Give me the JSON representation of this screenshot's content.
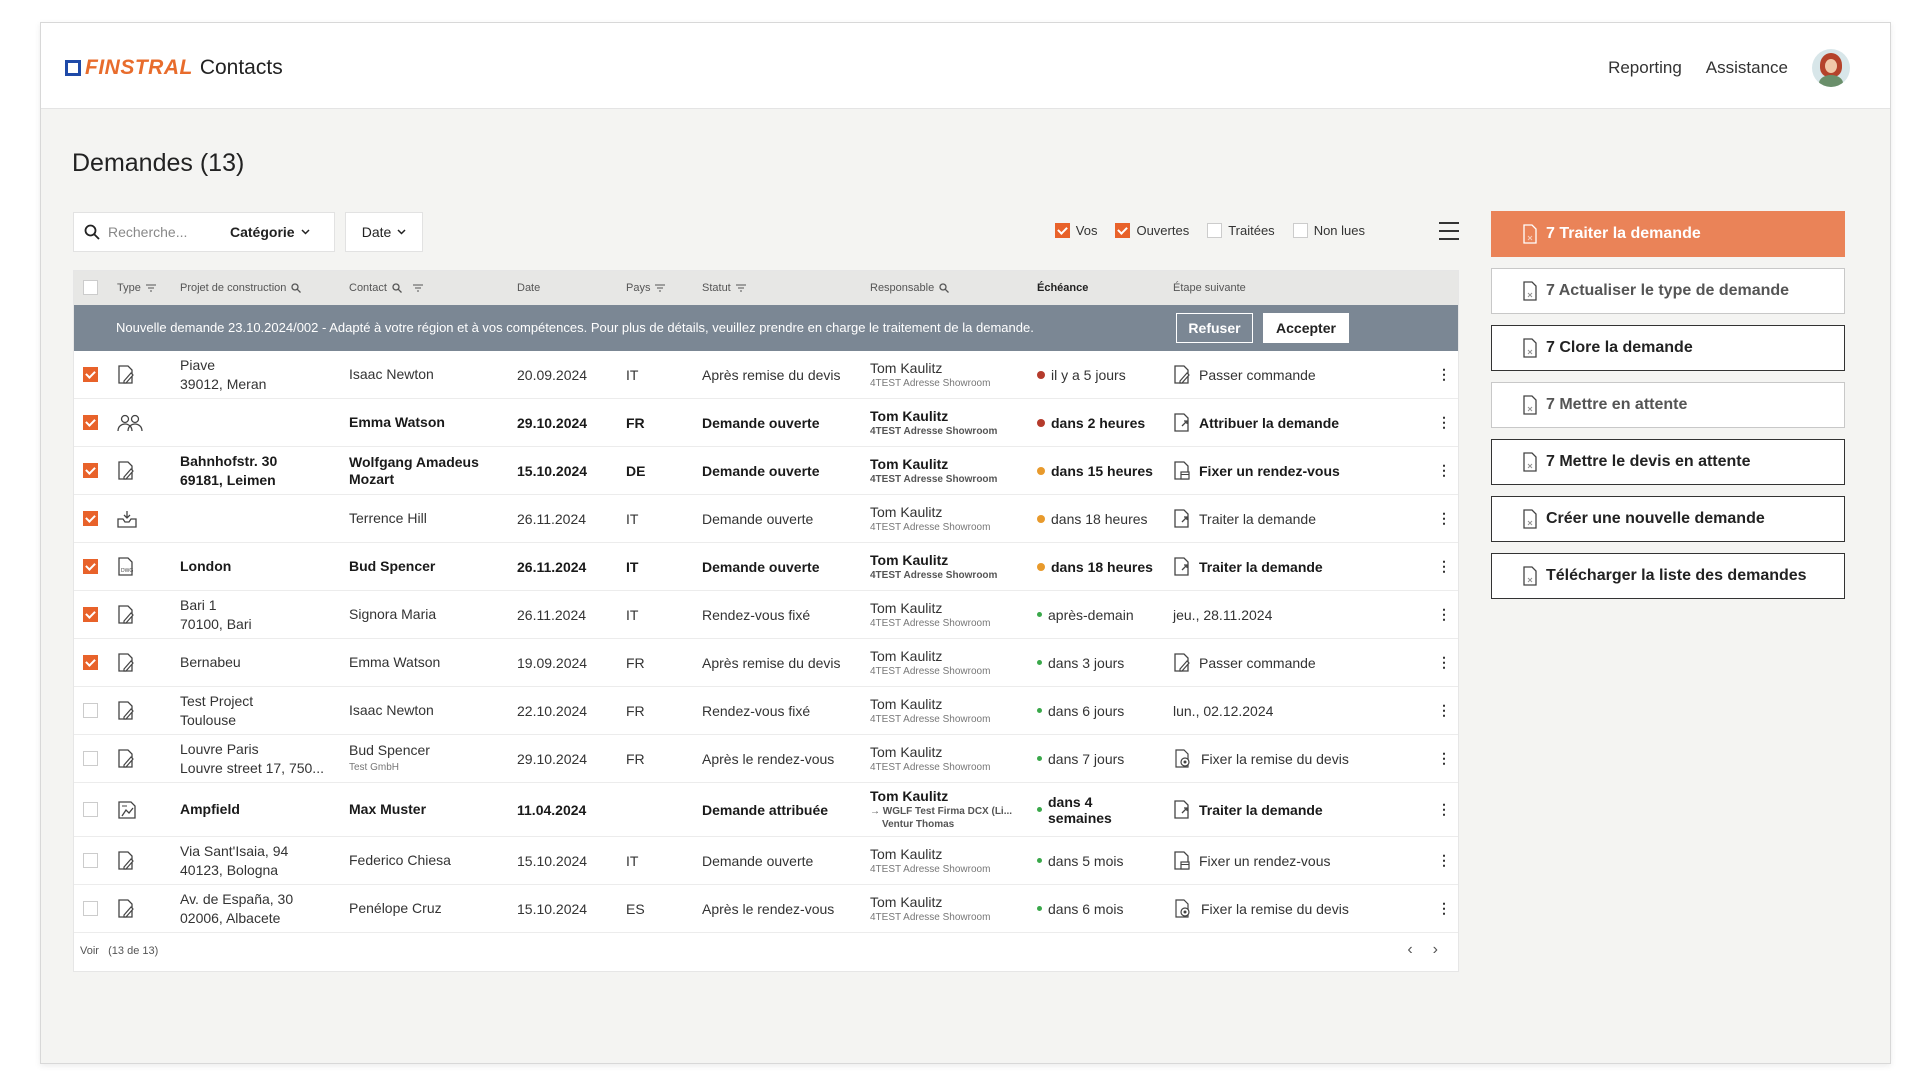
{
  "header": {
    "brand": "FINSTRAL",
    "app": "Contacts",
    "nav": [
      "Reporting",
      "Assistance"
    ]
  },
  "page": {
    "title": "Demandes (13)"
  },
  "toolbar": {
    "search_placeholder": "Recherche...",
    "category": "Catégorie",
    "date": "Date",
    "filters": [
      {
        "label": "Vos",
        "checked": true
      },
      {
        "label": "Ouvertes",
        "checked": true
      },
      {
        "label": "Traitées",
        "checked": false
      },
      {
        "label": "Non lues",
        "checked": false
      }
    ]
  },
  "table": {
    "columns": {
      "type": "Type",
      "project": "Projet de construction",
      "contact": "Contact",
      "date": "Date",
      "country": "Pays",
      "status": "Statut",
      "responsible": "Responsable",
      "due": "Échéance",
      "next_step": "Étape suivante"
    },
    "banner": {
      "text": "Nouvelle demande 23.10.2024/002 - Adapté à votre région et à vos compétences. Pour plus de détails, veuillez prendre en charge le traitement de la demande.",
      "refuse": "Refuser",
      "accept": "Accepter"
    },
    "rows": [
      {
        "checked": true,
        "type_icon": "document-edit-icon",
        "project1": "Piave",
        "project2": "39012, Meran",
        "contact1": "Isaac Newton",
        "contact2": "",
        "date": "20.09.2024",
        "country": "IT",
        "status": "Après remise du devis",
        "resp": "Tom Kaulitz",
        "resp_sub": "4TEST Adresse Showroom",
        "due": "il y a 5 jours",
        "due_color": "#b53b2c",
        "step_icon": "document-edit-icon",
        "step": "Passer commande",
        "bold": false
      },
      {
        "checked": true,
        "type_icon": "people-icon",
        "project1": "",
        "project2": "",
        "contact1": "Emma Watson",
        "contact2": "",
        "date": "29.10.2024",
        "country": "FR",
        "status": "Demande ouverte",
        "resp": "Tom Kaulitz",
        "resp_sub": "4TEST Adresse Showroom",
        "due": "dans 2 heures",
        "due_color": "#b53b2c",
        "step_icon": "document-arrow-icon",
        "step": "Attribuer la demande",
        "bold": true
      },
      {
        "checked": true,
        "type_icon": "document-edit-icon",
        "project1": "Bahnhofstr. 30",
        "project2": "69181, Leimen",
        "contact1": "Wolfgang Amadeus",
        "contact2": "Mozart",
        "date": "15.10.2024",
        "country": "DE",
        "status": "Demande ouverte",
        "resp": "Tom Kaulitz",
        "resp_sub": "4TEST Adresse Showroom",
        "due": "dans 15 heures",
        "due_color": "#e89a2c",
        "step_icon": "document-calendar-icon",
        "step": "Fixer un rendez-vous",
        "bold": true
      },
      {
        "checked": true,
        "type_icon": "inbox-icon",
        "project1": "",
        "project2": "",
        "contact1": "Terrence Hill",
        "contact2": "",
        "date": "26.11.2024",
        "country": "IT",
        "status": "Demande ouverte",
        "resp": "Tom Kaulitz",
        "resp_sub": "4TEST Adresse Showroom",
        "due": "dans 18 heures",
        "due_color": "#e89a2c",
        "step_icon": "document-arrow-icon",
        "step": "Traiter la demande",
        "bold": false
      },
      {
        "checked": true,
        "type_icon": "document-dwg-icon",
        "project1": "London",
        "project2": "",
        "contact1": "Bud Spencer",
        "contact2": "",
        "date": "26.11.2024",
        "country": "IT",
        "status": "Demande ouverte",
        "resp": "Tom Kaulitz",
        "resp_sub": "4TEST Adresse Showroom",
        "due": "dans 18 heures",
        "due_color": "#e89a2c",
        "step_icon": "document-arrow-icon",
        "step": "Traiter la demande",
        "bold": true
      },
      {
        "checked": true,
        "type_icon": "document-edit-icon",
        "project1": "Bari 1",
        "project2": "70100, Bari",
        "contact1": "Signora Maria",
        "contact2": "",
        "date": "26.11.2024",
        "country": "IT",
        "status": "Rendez-vous fixé",
        "resp": "Tom Kaulitz",
        "resp_sub": "4TEST Adresse Showroom",
        "due": "après-demain",
        "due_color": "#3aa84a",
        "step_icon": "",
        "step": "jeu., 28.11.2024",
        "bold": false
      },
      {
        "checked": true,
        "type_icon": "document-edit-icon",
        "project1": "Bernabeu",
        "project2": "",
        "contact1": "Emma Watson",
        "contact2": "",
        "date": "19.09.2024",
        "country": "FR",
        "status": "Après remise du devis",
        "resp": "Tom Kaulitz",
        "resp_sub": "4TEST Adresse Showroom",
        "due": "dans 3 jours",
        "due_color": "#3aa84a",
        "step_icon": "document-edit-icon",
        "step": "Passer commande",
        "bold": false
      },
      {
        "checked": false,
        "type_icon": "document-edit-icon",
        "project1": "Test Project",
        "project2": "Toulouse",
        "contact1": "Isaac Newton",
        "contact2": "",
        "date": "22.10.2024",
        "country": "FR",
        "status": "Rendez-vous fixé",
        "resp": "Tom Kaulitz",
        "resp_sub": "4TEST Adresse Showroom",
        "due": "dans 6 jours",
        "due_color": "#3aa84a",
        "step_icon": "",
        "step": "lun., 02.12.2024",
        "bold": false
      },
      {
        "checked": false,
        "type_icon": "document-edit-icon",
        "project1": "Louvre Paris",
        "project2": "Louvre street 17, 750...",
        "contact1": "Bud Spencer",
        "contact2": "Test GmbH",
        "date": "29.10.2024",
        "country": "FR",
        "status": "Après le rendez-vous",
        "resp": "Tom Kaulitz",
        "resp_sub": "4TEST Adresse Showroom",
        "due": "dans 7 jours",
        "due_color": "#3aa84a",
        "step_icon": "gear-doc-icon",
        "step": "Fixer la remise du devis",
        "bold": false
      },
      {
        "checked": false,
        "type_icon": "document-plan-icon",
        "project1": "Ampfield",
        "project2": "",
        "contact1": "Max Muster",
        "contact2": "",
        "date": "11.04.2024",
        "country": "",
        "status": "Demande attribuée",
        "resp": "Tom Kaulitz",
        "resp_sub": "→ WGLF Test Firma DCX (Li...",
        "resp_sub2": "Ventur Thomas",
        "due": "dans 4 semaines",
        "due_color": "#3aa84a",
        "step_icon": "document-arrow-icon",
        "step": "Traiter la demande",
        "bold": true,
        "tall": true
      },
      {
        "checked": false,
        "type_icon": "document-edit-icon",
        "project1": "Via Sant'Isaia, 94",
        "project2": "40123, Bologna",
        "contact1": "Federico Chiesa",
        "contact2": "",
        "date": "15.10.2024",
        "country": "IT",
        "status": "Demande ouverte",
        "resp": "Tom Kaulitz",
        "resp_sub": "4TEST Adresse Showroom",
        "due": "dans 5 mois",
        "due_color": "#3aa84a",
        "step_icon": "document-calendar-icon",
        "step": "Fixer un rendez-vous",
        "bold": false
      },
      {
        "checked": false,
        "type_icon": "document-edit-icon",
        "project1": "Av. de España, 30",
        "project2": "02006, Albacete",
        "contact1": "Penélope Cruz",
        "contact2": "",
        "date": "15.10.2024",
        "country": "ES",
        "status": "Après le rendez-vous",
        "resp": "Tom Kaulitz",
        "resp_sub": "4TEST Adresse Showroom",
        "due": "dans 6 mois",
        "due_color": "#3aa84a",
        "step_icon": "gear-doc-icon",
        "step": "Fixer la remise du devis",
        "bold": false
      }
    ],
    "footer": {
      "label": "Voir",
      "count": "(13 de 13)"
    }
  },
  "actions": [
    {
      "label": "7 Traiter la demande",
      "style": "primary"
    },
    {
      "label": "7 Actualiser le type de demande",
      "style": "disabled"
    },
    {
      "label": "7 Clore la demande",
      "style": "normal"
    },
    {
      "label": "7 Mettre en attente",
      "style": "disabled"
    },
    {
      "label": "7 Mettre le devis en attente",
      "style": "normal"
    },
    {
      "label": "Créer une nouvelle demande",
      "style": "normal"
    },
    {
      "label": "Télécharger la liste des demandes",
      "style": "normal"
    }
  ],
  "colors": {
    "accent": "#e8622a",
    "banner": "#7b8794",
    "overdue": "#b53b2c",
    "soon": "#e89a2c",
    "ok": "#3aa84a"
  }
}
